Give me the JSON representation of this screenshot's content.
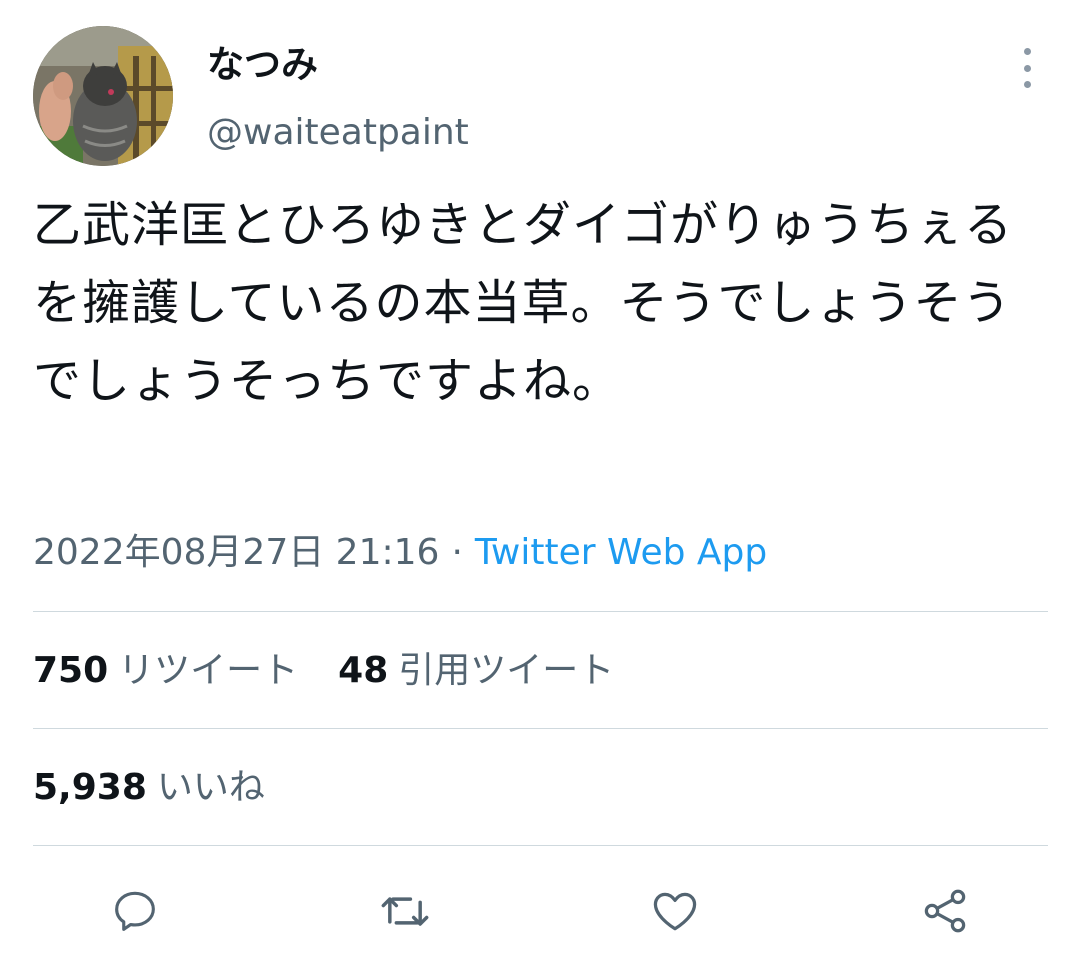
{
  "user": {
    "display_name": "なつみ",
    "handle": "@waiteatpaint"
  },
  "tweet": {
    "text": "乙武洋匡とひろゆきとダイゴがりゅうちぇるを擁護しているの本当草。そうでしょうそうでしょうそっちですよね。",
    "timestamp": "2022年08月27日 21:16",
    "separator": "·",
    "source": "Twitter Web App"
  },
  "stats": {
    "retweets_count": "750",
    "retweets_label": "リツイート",
    "quotes_count": "48",
    "quotes_label": "引用ツイート",
    "likes_count": "5,938",
    "likes_label": "いいね"
  },
  "icons": {
    "reply": "reply-icon",
    "retweet": "retweet-icon",
    "like": "like-icon",
    "share": "share-icon",
    "more": "more-icon"
  },
  "colors": {
    "text": "#0f1419",
    "secondary": "#536471",
    "link": "#1d9bf0",
    "divider": "#cfd9de"
  }
}
